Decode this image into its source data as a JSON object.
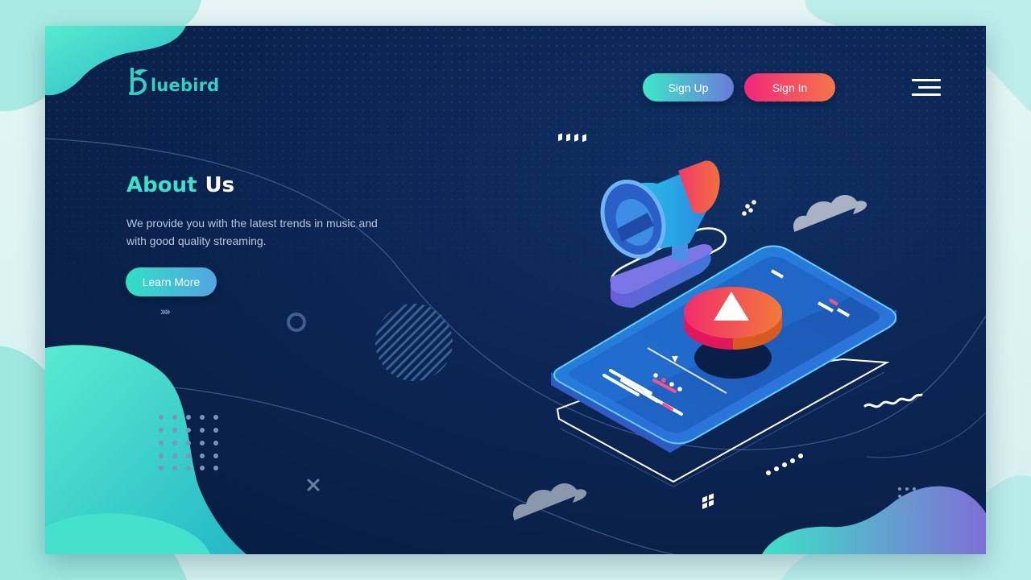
{
  "brand": {
    "name": "luebird",
    "logo_icon": "bluebird-logo-icon",
    "accent": "#33d1c3"
  },
  "header": {
    "signup_label": "Sign Up",
    "signin_label": "Sign In",
    "menu_icon": "hamburger-menu-icon"
  },
  "hero": {
    "title_part1": "About",
    "title_part2": "Us",
    "description": "We provide you with the latest trends in music and with good quality streaming.",
    "cta_label": "Learn More",
    "scroll_hint": "››››"
  },
  "colors": {
    "background": "#0b2552",
    "signup_gradient": [
      "#3ee6c9",
      "#6a7bd8"
    ],
    "signin_gradient": [
      "#f2267a",
      "#f5764a"
    ],
    "cta_gradient": [
      "#2fe0c6",
      "#54a4e2"
    ]
  }
}
